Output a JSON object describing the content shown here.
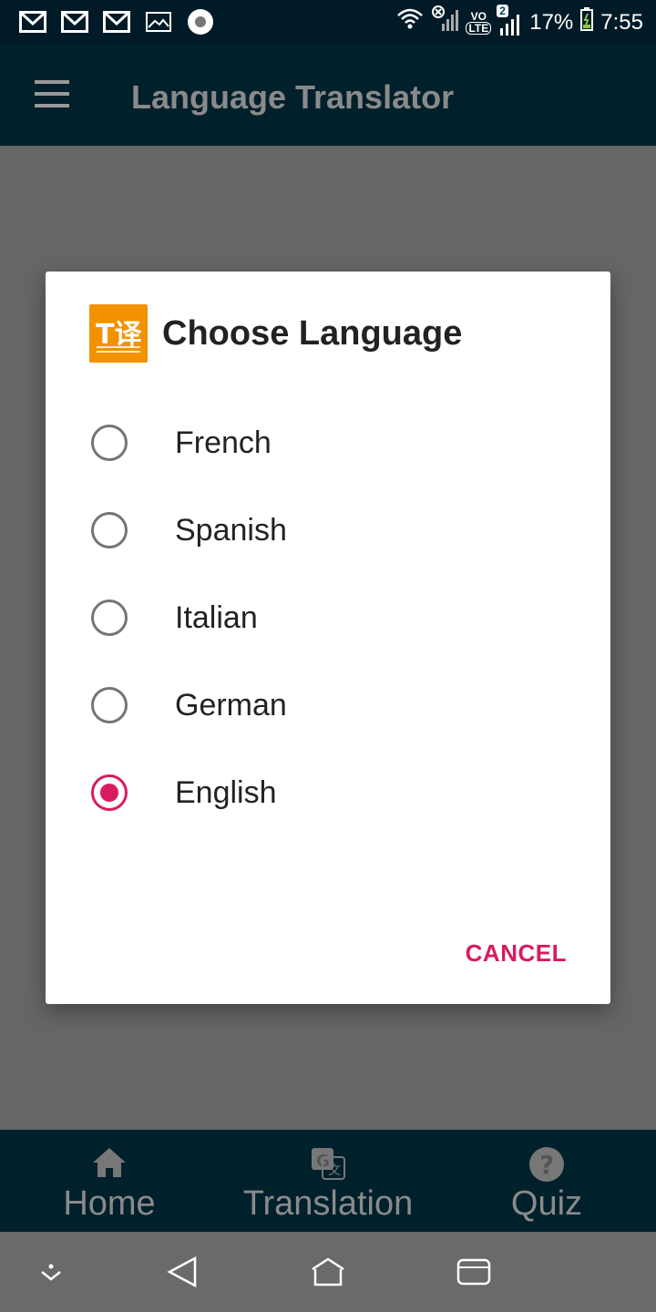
{
  "status_bar": {
    "left_icons": [
      "gmail-icon",
      "gmail-icon",
      "gmail-icon",
      "image-icon",
      "record-icon"
    ],
    "battery": "17%",
    "time": "7:55",
    "sim_badge": "2",
    "network_labels": [
      "VO",
      "LTE"
    ]
  },
  "app_bar": {
    "title": "Language Translator",
    "menu_icon": "hamburger-icon"
  },
  "dialog": {
    "title": "Choose Language",
    "logo_text": "T译",
    "options": [
      {
        "label": "French",
        "checked": false
      },
      {
        "label": "Spanish",
        "checked": false
      },
      {
        "label": "Italian",
        "checked": false
      },
      {
        "label": "German",
        "checked": false
      },
      {
        "label": "English",
        "checked": true
      }
    ],
    "cancel_label": "CANCEL",
    "accent_color": "#d81b60",
    "logo_color": "#f39200"
  },
  "bottom_nav": {
    "items": [
      {
        "label": "Home",
        "icon": "home-icon"
      },
      {
        "label": "Translation",
        "icon": "translate-icon"
      },
      {
        "label": "Quiz",
        "icon": "help-icon"
      }
    ]
  },
  "system_nav": {
    "icons": [
      "expand-icon",
      "back-icon",
      "home-nav-icon",
      "recents-icon"
    ]
  },
  "colors": {
    "primary": "#02526f",
    "status_bar": "#013d57"
  }
}
